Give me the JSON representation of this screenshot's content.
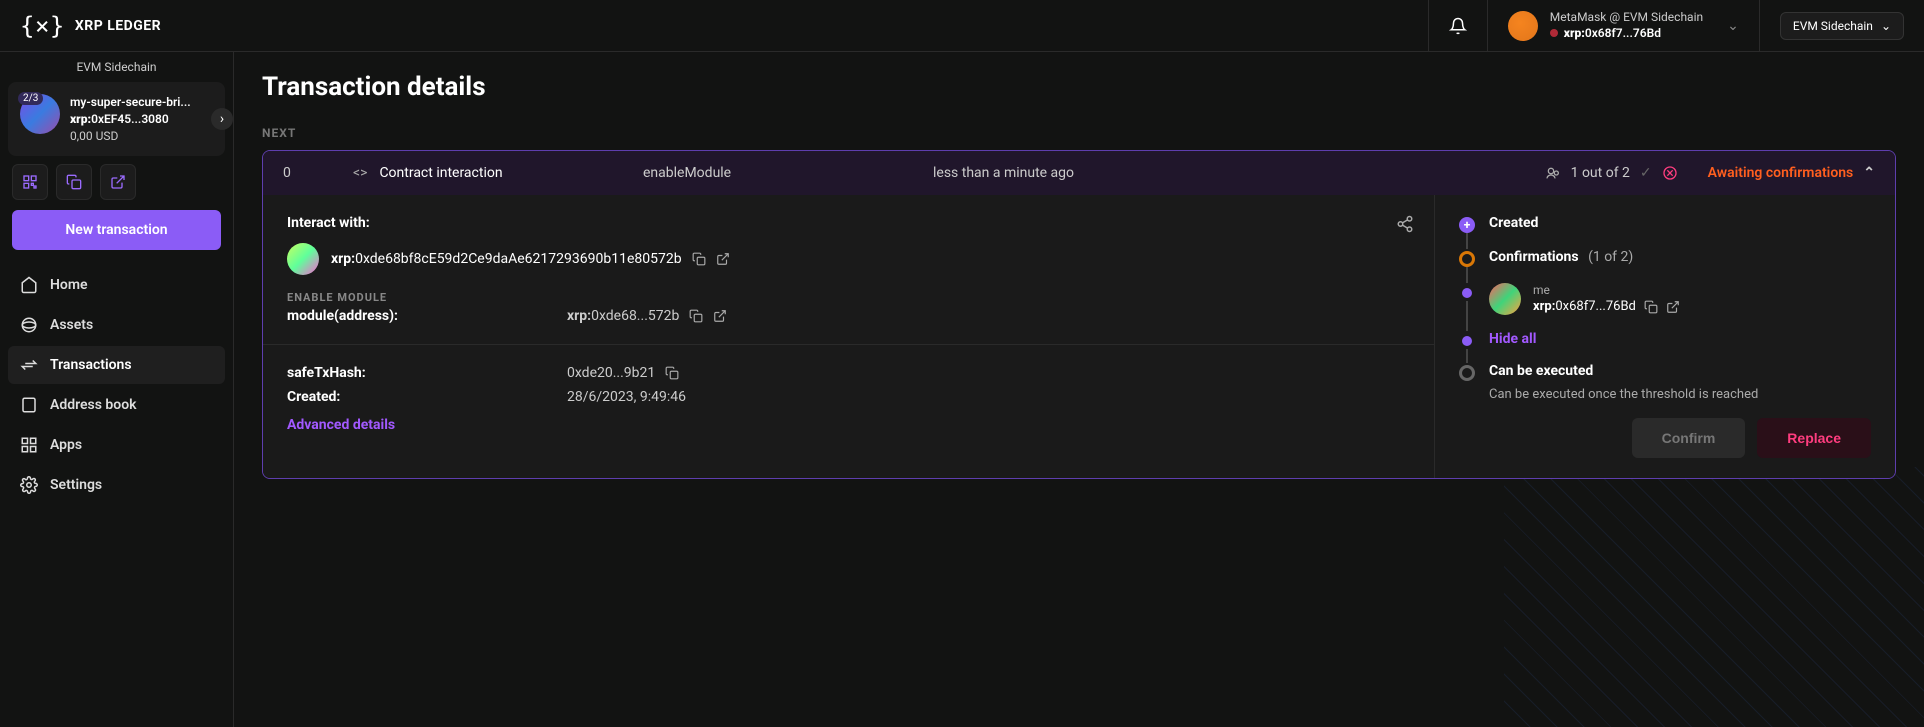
{
  "topbar": {
    "brand": "XRP LEDGER",
    "wallet_label": "MetaMask @ EVM Sidechain",
    "wallet_prefix": "xrp:",
    "wallet_addr": "0x68f7...76Bd",
    "chain": "EVM Sidechain"
  },
  "sidebar": {
    "chain_label": "EVM Sidechain",
    "safe": {
      "threshold": "2/3",
      "name": "my-super-secure-bri...",
      "addr_prefix": "xrp:",
      "addr": "0xEF45...3080",
      "balance": "0,00 USD"
    },
    "new_tx": "New transaction",
    "nav": {
      "home": "Home",
      "assets": "Assets",
      "transactions": "Transactions",
      "address_book": "Address book",
      "apps": "Apps",
      "settings": "Settings"
    }
  },
  "page": {
    "title": "Transaction details",
    "section_next": "NEXT"
  },
  "tx": {
    "nonce": "0",
    "type": "Contract interaction",
    "method": "enableModule",
    "time": "less than a minute ago",
    "sigs": "1 out of 2",
    "status": "Awaiting confirmations"
  },
  "details": {
    "interact_label": "Interact with:",
    "interact_prefix": "xrp:",
    "interact_addr": "0xde68bf8cE59d2Ce9daAe6217293690b11e80572b",
    "enable_module_label": "ENABLE MODULE",
    "module_key": "module(address):",
    "module_prefix": "xrp:",
    "module_val": "0xde68...572b",
    "hash_key": "safeTxHash:",
    "hash_val": "0xde20...9b21",
    "created_key": "Created:",
    "created_val": "28/6/2023, 9:49:46",
    "advanced": "Advanced details"
  },
  "timeline": {
    "created": "Created",
    "confirmations": "Confirmations",
    "confirmations_count": "(1 of 2)",
    "signer_me": "me",
    "signer_prefix": "xrp:",
    "signer_addr": "0x68f7...76Bd",
    "hide_all": "Hide all",
    "can_execute": "Can be executed",
    "execute_note": "Can be executed once the threshold is reached",
    "confirm_btn": "Confirm",
    "replace_btn": "Replace"
  }
}
